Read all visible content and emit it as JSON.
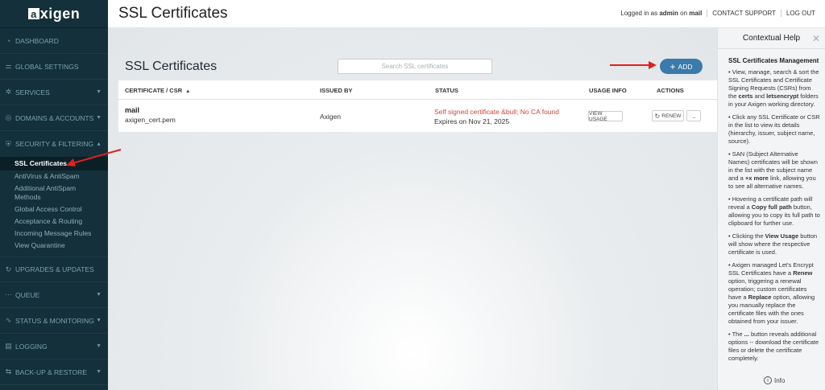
{
  "logo": {
    "mark": "a",
    "text": "xigen"
  },
  "topbar": {
    "title": "SSL Certificates",
    "logged_prefix": "Logged in as",
    "user": "admin",
    "on": "on",
    "domain": "mail",
    "contact": "CONTACT SUPPORT",
    "logout": "LOG OUT"
  },
  "sidebar": {
    "items": [
      {
        "label": "DASHBOARD",
        "icon": "gauge-icon"
      },
      {
        "label": "GLOBAL SETTINGS",
        "icon": "sliders-icon"
      },
      {
        "label": "SERVICES",
        "icon": "gear-icon"
      },
      {
        "label": "DOMAINS & ACCOUNTS",
        "icon": "globe-icon"
      },
      {
        "label": "SECURITY & FILTERING",
        "icon": "shield-icon"
      },
      {
        "label": "UPGRADES & UPDATES",
        "icon": "refresh-icon"
      },
      {
        "label": "QUEUE",
        "icon": "dots-icon"
      },
      {
        "label": "STATUS & MONITORING",
        "icon": "pulse-icon"
      },
      {
        "label": "LOGGING",
        "icon": "log-icon"
      },
      {
        "label": "BACK-UP & RESTORE",
        "icon": "backup-icon"
      }
    ],
    "security_sub": [
      "SSL Certificates",
      "AntiVirus & AntiSpam",
      "Additional AntiSpam",
      "Methods",
      "Global Access Control",
      "Acceptance & Routing",
      "Incoming Message Rules",
      "View Quarantine"
    ]
  },
  "main": {
    "title": "SSL Certificates",
    "search_placeholder": "Search SSL certificates",
    "add_label": "ADD",
    "columns": {
      "cert": "CERTIFICATE / CSR",
      "issued": "ISSUED BY",
      "status": "STATUS",
      "usage": "USAGE INFO",
      "actions": "ACTIONS"
    },
    "rows": [
      {
        "name": "mail",
        "file": "axigen_cert.pem",
        "issuer": "Axigen",
        "status_error": "Self signed certificate &bull; No CA found",
        "expires": "Expires on Nov 21, 2025",
        "usage_btn": "VIEW USAGE",
        "renew_btn": "RENEW",
        "more_btn": "..."
      }
    ]
  },
  "help": {
    "title": "Contextual Help",
    "heading": "SSL Certificates Management",
    "info": "Info",
    "p1a": "View, manage, search & sort the SSL Certificates and Certificate Signing Requests (CSRs) from the",
    "p1_certs": "certs",
    "p1_and": "and",
    "p1_le": "letsencrypt",
    "p1b": "folders in your Axigen  working directory.",
    "p2": "Click any SSL Certificate or CSR in the list to view its details (hierarchy, issuer, subject name, source).",
    "p3a": "SAN (Subject Alternative Names) certificates will be shown in the list with the subject name and a",
    "p3b": "+x more",
    "p3c": "link, allowing you to see all alternative names.",
    "p4a": "Hovering a certificate path will reveal a",
    "p4b": "Copy full path",
    "p4c": "button, allowing you to copy its full path to clipboard for further use.",
    "p5a": "Clicking the",
    "p5b": "View Usage",
    "p5c": "button will show where the respective certificate is used.",
    "p6a": "Axigen  managed Let's Encrypt SSL Certificates have a",
    "p6b": "Renew",
    "p6c": "option, triggering a renewal operation; custom certificates have a",
    "p6d": "Replace",
    "p6e": "option, allowing you manually replace the certificate files with the ones obtained from your issuer.",
    "p7a": "The",
    "p7b": "...",
    "p7c": "button reveals additional options -- download the certificate files or delete the certificate completely."
  },
  "colors": {
    "sidebar": "#14303a",
    "accent": "#3a7bab",
    "error": "#d0463a",
    "annotation": "#e02020"
  }
}
